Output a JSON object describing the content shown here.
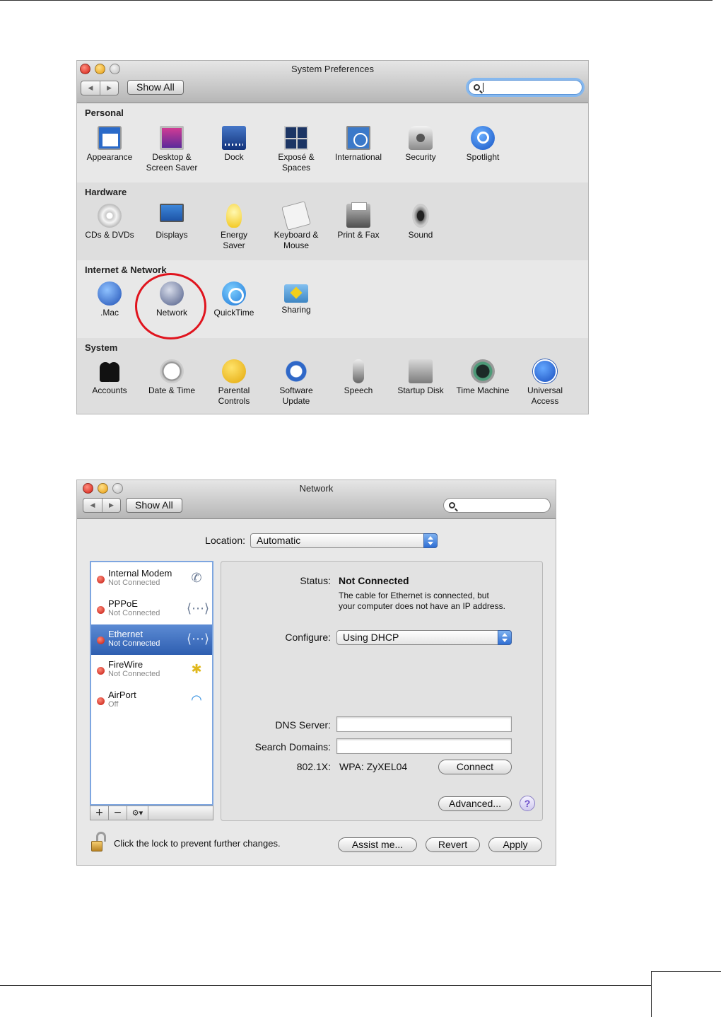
{
  "sysprefs": {
    "title": "System Preferences",
    "show_all": "Show All",
    "sections": {
      "personal": {
        "title": "Personal",
        "items": [
          {
            "label": "Appearance",
            "icon": "appearance-icon"
          },
          {
            "label": "Desktop &\nScreen Saver",
            "icon": "desktop-icon"
          },
          {
            "label": "Dock",
            "icon": "dock-icon"
          },
          {
            "label": "Exposé &\nSpaces",
            "icon": "expose-icon"
          },
          {
            "label": "International",
            "icon": "international-icon"
          },
          {
            "label": "Security",
            "icon": "security-icon"
          },
          {
            "label": "Spotlight",
            "icon": "spotlight-icon"
          }
        ]
      },
      "hardware": {
        "title": "Hardware",
        "items": [
          {
            "label": "CDs & DVDs",
            "icon": "cd-icon"
          },
          {
            "label": "Displays",
            "icon": "display-icon"
          },
          {
            "label": "Energy\nSaver",
            "icon": "lightbulb-icon"
          },
          {
            "label": "Keyboard &\nMouse",
            "icon": "keyboard-icon"
          },
          {
            "label": "Print & Fax",
            "icon": "printer-icon"
          },
          {
            "label": "Sound",
            "icon": "speaker-icon"
          }
        ]
      },
      "internet": {
        "title": "Internet & Network",
        "items": [
          {
            "label": ".Mac",
            "icon": "globe-icon"
          },
          {
            "label": "Network",
            "icon": "network-globe-icon"
          },
          {
            "label": "QuickTime",
            "icon": "quicktime-icon"
          },
          {
            "label": "Sharing",
            "icon": "sharing-folder-icon"
          }
        ]
      },
      "system": {
        "title": "System",
        "items": [
          {
            "label": "Accounts",
            "icon": "accounts-icon"
          },
          {
            "label": "Date & Time",
            "icon": "clock-calendar-icon"
          },
          {
            "label": "Parental\nControls",
            "icon": "parental-icon"
          },
          {
            "label": "Software\nUpdate",
            "icon": "software-update-icon"
          },
          {
            "label": "Speech",
            "icon": "microphone-icon"
          },
          {
            "label": "Startup Disk",
            "icon": "disk-icon"
          },
          {
            "label": "Time Machine",
            "icon": "time-machine-icon"
          },
          {
            "label": "Universal\nAccess",
            "icon": "accessibility-icon"
          }
        ]
      }
    },
    "highlight_color": "#e0141e"
  },
  "network": {
    "title": "Network",
    "show_all": "Show All",
    "location_label": "Location:",
    "location_value": "Automatic",
    "services": [
      {
        "name": "Internal Modem",
        "status": "Not Connected",
        "icon": "phone-icon",
        "selected": false
      },
      {
        "name": "PPPoE",
        "status": "Not Connected",
        "icon": "ethernet-arrows-icon",
        "selected": false
      },
      {
        "name": "Ethernet",
        "status": "Not Connected",
        "icon": "ethernet-arrows-icon",
        "selected": true
      },
      {
        "name": "FireWire",
        "status": "Not Connected",
        "icon": "firewire-icon",
        "selected": false
      },
      {
        "name": "AirPort",
        "status": "Off",
        "icon": "wifi-icon",
        "selected": false
      }
    ],
    "list_toolbar": {
      "add": "+",
      "remove": "−",
      "gear": "⚙▾"
    },
    "status_label": "Status:",
    "status_value": "Not Connected",
    "status_desc": "The cable for Ethernet is connected, but\nyour computer does not have an IP address.",
    "configure_label": "Configure:",
    "configure_value": "Using DHCP",
    "dns_label": "DNS Server:",
    "dns_value": "",
    "search_domains_label": "Search Domains:",
    "search_domains_value": "",
    "dot1x_label": "802.1X:",
    "dot1x_value": "WPA: ZyXEL04",
    "connect_label": "Connect",
    "advanced_label": "Advanced...",
    "help_label": "?",
    "lock_text": "Click the lock to prevent further changes.",
    "assist_label": "Assist me...",
    "revert_label": "Revert",
    "apply_label": "Apply",
    "colors": {
      "selection": "#2e5eb0",
      "status_dot": "#c0140a"
    }
  }
}
